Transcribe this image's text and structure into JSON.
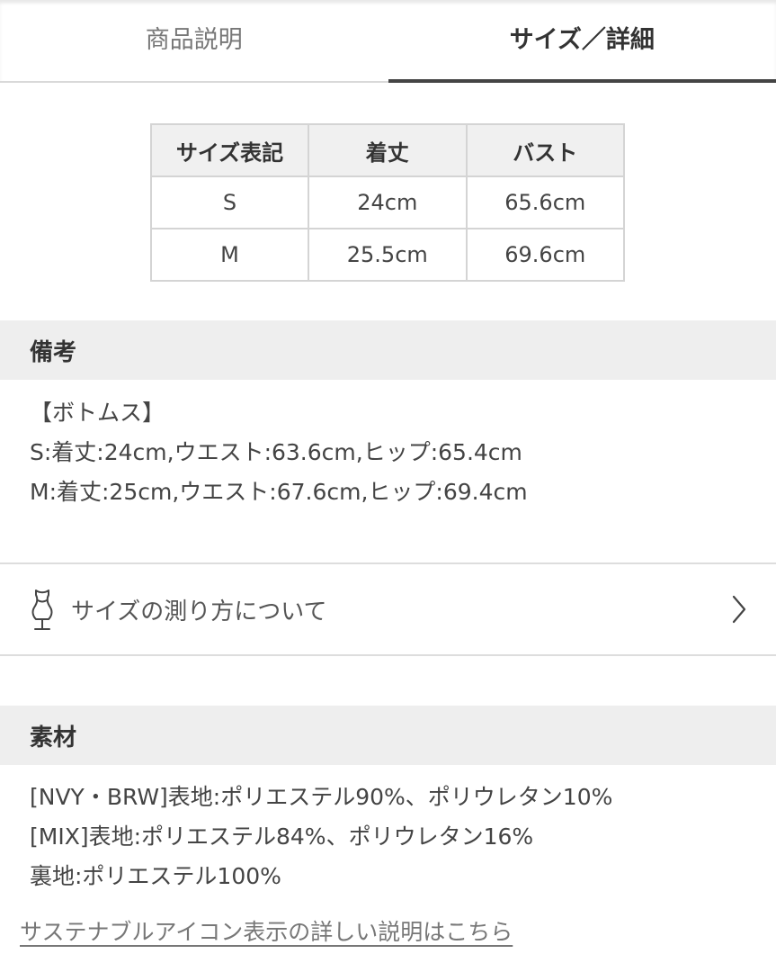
{
  "tabs": [
    {
      "label": "商品説明",
      "active": false
    },
    {
      "label": "サイズ／詳細",
      "active": true
    }
  ],
  "size_table": {
    "headers": [
      "サイズ表記",
      "着丈",
      "バスト"
    ],
    "rows": [
      [
        "S",
        "24cm",
        "65.6cm"
      ],
      [
        "M",
        "25.5cm",
        "69.6cm"
      ]
    ]
  },
  "notes": {
    "title": "備考",
    "lines": [
      "【ボトムス】",
      "S:着丈:24cm,ウエスト:63.6cm,ヒップ:65.4cm",
      "M:着丈:25cm,ウエスト:67.6cm,ヒップ:69.4cm"
    ]
  },
  "measure_link": {
    "label": "サイズの測り方について",
    "icon": "dress-form-icon"
  },
  "material": {
    "title": "素材",
    "lines": [
      "[NVY・BRW]表地:ポリエステル90%、ポリウレタン10%",
      "[MIX]表地:ポリエステル84%、ポリウレタン16%",
      "裏地:ポリエステル100%"
    ]
  },
  "sustainable_link": "サステナブルアイコン表示の詳しい説明はこちら",
  "colors": {
    "section_bg": "#eeeeee",
    "table_header_bg": "#f0f0f0",
    "border": "#d4d4d4",
    "active_tab_indicator": "#444444"
  }
}
